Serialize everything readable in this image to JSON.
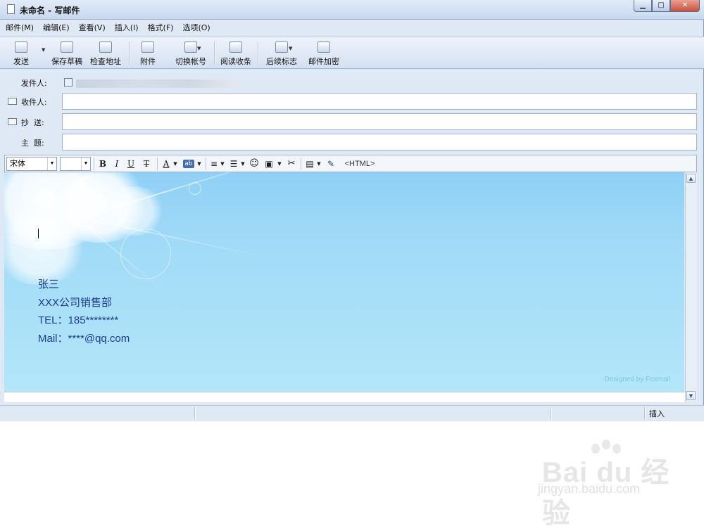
{
  "window": {
    "title": "未命名 - 写邮件",
    "controls": {
      "minimize": "▁",
      "maximize": "□",
      "close": "✕"
    }
  },
  "menu": {
    "items": [
      "邮件(M)",
      "编辑(E)",
      "查看(V)",
      "插入(I)",
      "格式(F)",
      "选项(O)"
    ]
  },
  "toolbar": {
    "send": "发送",
    "save_draft": "保存草稿",
    "check_address": "检查地址",
    "attachment": "附件",
    "switch_account": "切换帐号",
    "read_receipt": "阅读收条",
    "follow_up": "后续标志",
    "encrypt": "邮件加密"
  },
  "header": {
    "from_label": "发件人:",
    "to_label": "收件人:",
    "cc_label": "抄  送:",
    "subject_label": "主  题:",
    "to_value": "",
    "cc_value": "",
    "subject_value": ""
  },
  "format_bar": {
    "font_name": "宋体",
    "font_size": "",
    "bold": "B",
    "italic": "I",
    "underline": "U",
    "strike": "T",
    "font_color": "A",
    "highlight": "ab",
    "html_toggle": "<HTML>"
  },
  "signature": {
    "name": "张三",
    "dept": "XXX公司销售部",
    "tel": "TEL：185********",
    "mail": "Mail：****@qq.com"
  },
  "stationery_credit": "Designed by Foxmail",
  "status": {
    "mode": "插入"
  },
  "watermark": {
    "brand": "Bai du 经验",
    "url": "jingyan.baidu.com"
  },
  "colors": {
    "signature_text": "#1f3a93",
    "sky_top": "#8fd0f6",
    "sky_bottom": "#b3e6f9"
  }
}
